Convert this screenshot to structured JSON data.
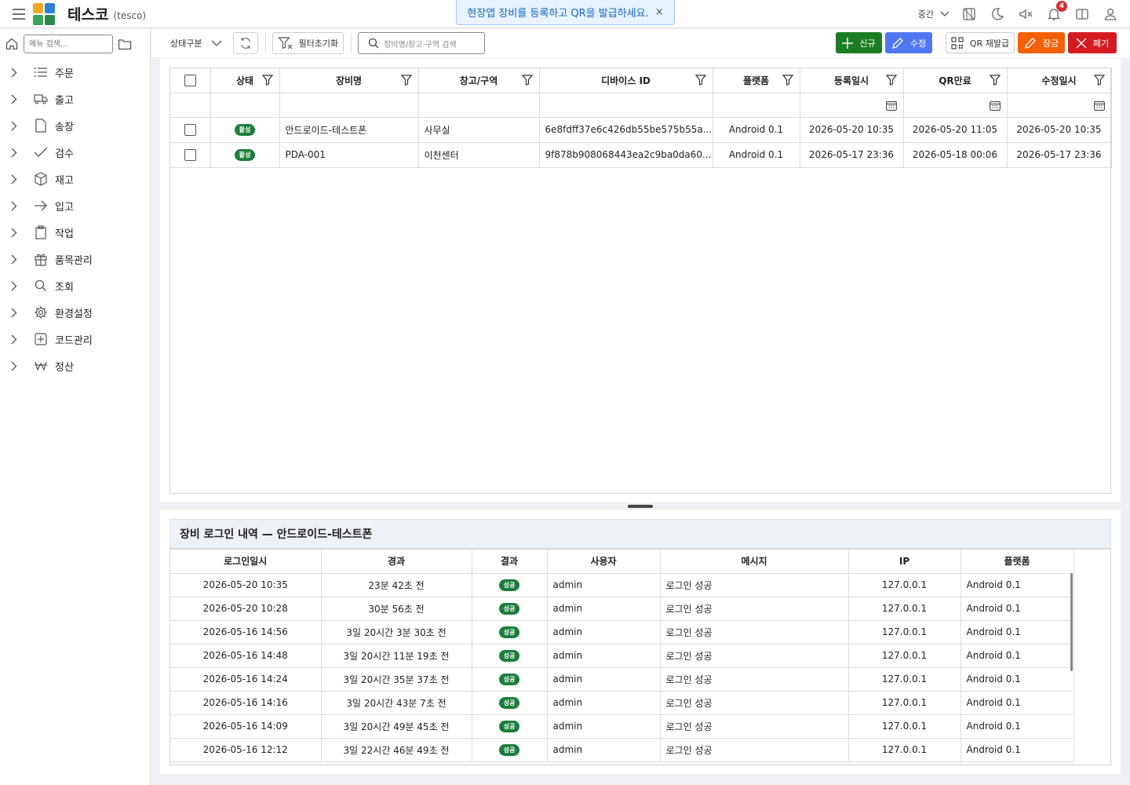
{
  "header": {
    "brand": "테스코",
    "brand_sub": "(tesco)",
    "toast": "현장앱 장비를 등록하고 QR을 발급하세요.",
    "toast_close": "×",
    "density_label": "중간",
    "notification_count": "4",
    "logo_colors": [
      "#f5a623",
      "#2f7fd6",
      "#3aa55d",
      "#2a8c4a"
    ]
  },
  "sidebar": {
    "search_placeholder": "메뉴 검색...",
    "items": [
      {
        "label": "주문",
        "icon": "list-icon"
      },
      {
        "label": "출고",
        "icon": "truck-icon"
      },
      {
        "label": "송장",
        "icon": "document-icon"
      },
      {
        "label": "검수",
        "icon": "check-icon"
      },
      {
        "label": "재고",
        "icon": "box-icon"
      },
      {
        "label": "입고",
        "icon": "arrow-right-icon"
      },
      {
        "label": "작업",
        "icon": "clipboard-icon"
      },
      {
        "label": "품목관리",
        "icon": "gift-icon"
      },
      {
        "label": "조회",
        "icon": "search-icon"
      },
      {
        "label": "환경설정",
        "icon": "gear-icon"
      },
      {
        "label": "코드관리",
        "icon": "plus-square-icon"
      },
      {
        "label": "정산",
        "icon": "won-icon"
      }
    ]
  },
  "toolbar": {
    "status_label": "상태구분",
    "reset_filter_label": "필터초기화",
    "search_placeholder": "장비명/창고·구역 검색",
    "new_label": "신규",
    "edit_label": "수정",
    "qr_label": "QR 재발급",
    "lock_label": "잠금",
    "discard_label": "폐기"
  },
  "devices": {
    "columns": [
      "상태",
      "장비명",
      "창고/구역",
      "디바이스 ID",
      "플랫폼",
      "등록일시",
      "QR만료",
      "수정일시"
    ],
    "rows": [
      {
        "status": "활성",
        "name": "안드로이드-테스트폰",
        "zone": "사무실",
        "device_id": "6e8fdff37e6c426db55be575b55a...",
        "platform": "Android 0.1",
        "registered": "2026-05-20 10:35",
        "qr_expiry": "2026-05-20 11:05",
        "modified": "2026-05-20 10:35"
      },
      {
        "status": "활성",
        "name": "PDA-001",
        "zone": "이천센터",
        "device_id": "9f878b908068443ea2c9ba0da60...",
        "platform": "Android 0.1",
        "registered": "2026-05-17 23:36",
        "qr_expiry": "2026-05-18 00:06",
        "modified": "2026-05-17 23:36"
      }
    ]
  },
  "login_history": {
    "title": "장비 로그인 내역 — 안드로이드-테스트폰",
    "columns": [
      "로그인일시",
      "경과",
      "결과",
      "사용자",
      "메시지",
      "IP",
      "플랫폼"
    ],
    "rows": [
      {
        "time": "2026-05-20 10:35",
        "elapsed": "23분 42초 전",
        "result": "성공",
        "user": "admin",
        "message": "로그인 성공",
        "ip": "127.0.0.1",
        "platform": "Android 0.1"
      },
      {
        "time": "2026-05-20 10:28",
        "elapsed": "30분 56초 전",
        "result": "성공",
        "user": "admin",
        "message": "로그인 성공",
        "ip": "127.0.0.1",
        "platform": "Android 0.1"
      },
      {
        "time": "2026-05-16 14:56",
        "elapsed": "3일 20시간 3분 30초 전",
        "result": "성공",
        "user": "admin",
        "message": "로그인 성공",
        "ip": "127.0.0.1",
        "platform": "Android 0.1"
      },
      {
        "time": "2026-05-16 14:48",
        "elapsed": "3일 20시간 11분 19초 전",
        "result": "성공",
        "user": "admin",
        "message": "로그인 성공",
        "ip": "127.0.0.1",
        "platform": "Android 0.1"
      },
      {
        "time": "2026-05-16 14:24",
        "elapsed": "3일 20시간 35분 37초 전",
        "result": "성공",
        "user": "admin",
        "message": "로그인 성공",
        "ip": "127.0.0.1",
        "platform": "Android 0.1"
      },
      {
        "time": "2026-05-16 14:16",
        "elapsed": "3일 20시간 43분 7초 전",
        "result": "성공",
        "user": "admin",
        "message": "로그인 성공",
        "ip": "127.0.0.1",
        "platform": "Android 0.1"
      },
      {
        "time": "2026-05-16 14:09",
        "elapsed": "3일 20시간 49분 45초 전",
        "result": "성공",
        "user": "admin",
        "message": "로그인 성공",
        "ip": "127.0.0.1",
        "platform": "Android 0.1"
      },
      {
        "time": "2026-05-16 12:12",
        "elapsed": "3일 22시간 46분 49초 전",
        "result": "성공",
        "user": "admin",
        "message": "로그인 성공",
        "ip": "127.0.0.1",
        "platform": "Android 0.1"
      }
    ]
  },
  "colors": {
    "new": "#1b7d23",
    "edit": "#5077f1",
    "lock": "#f4610a",
    "discard": "#d31c22",
    "status_pill": "#1b7d3a"
  }
}
